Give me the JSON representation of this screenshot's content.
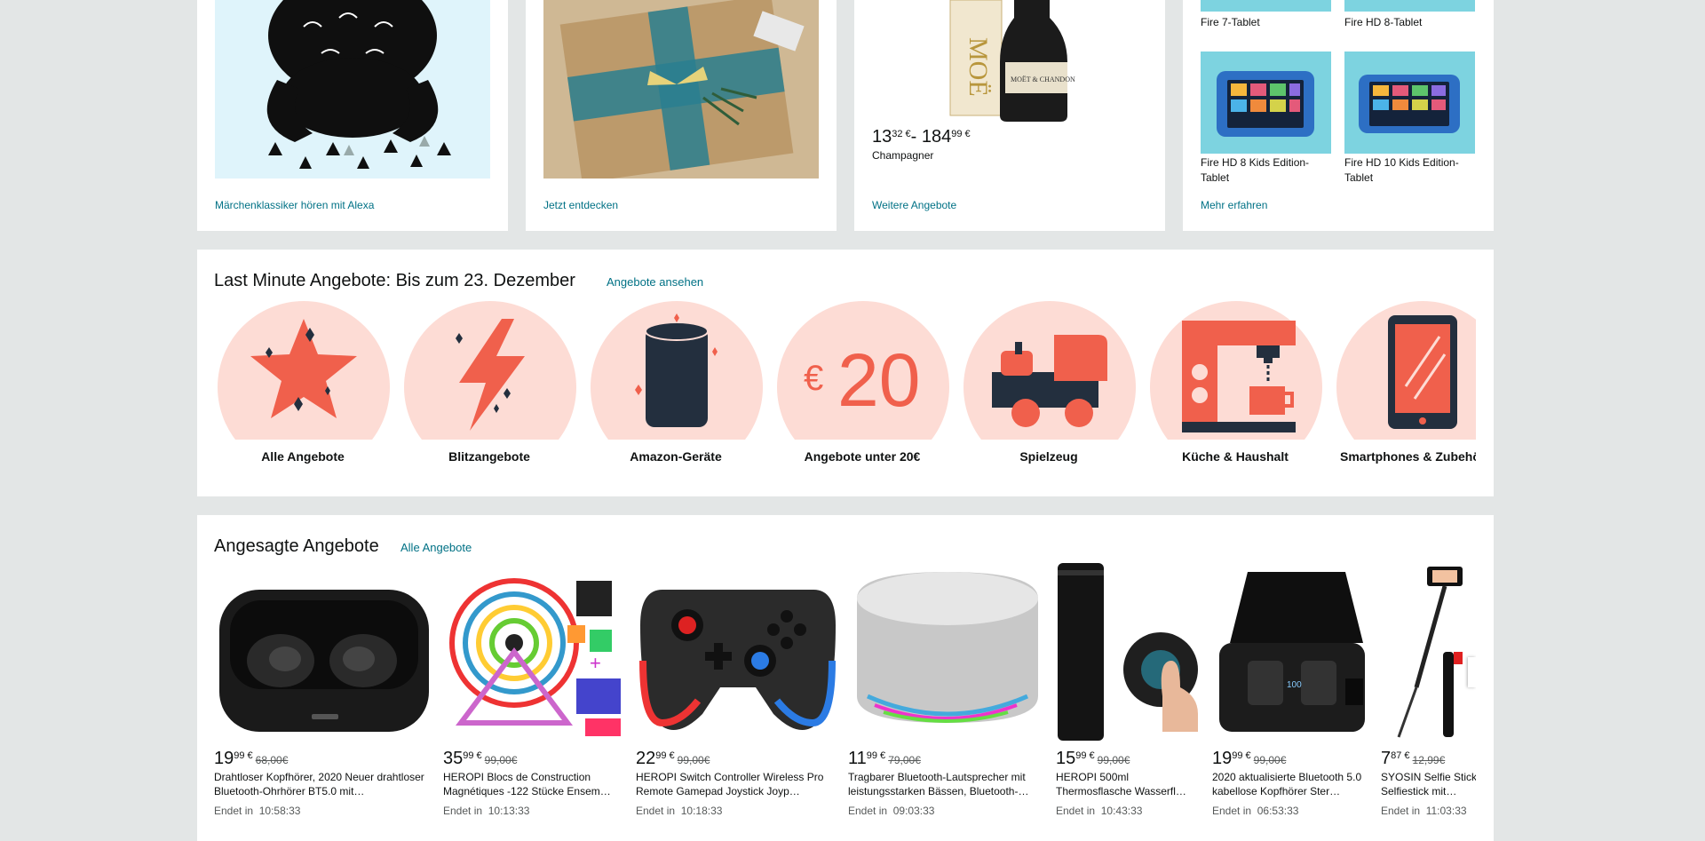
{
  "top_cards": [
    {
      "link": "Märchenklassiker hören mit Alexa"
    },
    {
      "link": "Jetzt entdecken"
    },
    {
      "price_low_main": "13",
      "price_low_sup": "32 €",
      "price_sep": "- ",
      "price_high_main": "184",
      "price_high_sup": "99 €",
      "caption": "Champagner",
      "link": "Weitere Angebote"
    },
    {
      "tablets": [
        "Fire 7-Tablet",
        "Fire HD 8-Tablet",
        "Fire HD 8 Kids Edition-Tablet",
        "Fire HD 10 Kids Edition-Tablet"
      ],
      "link": "Mehr erfahren"
    }
  ],
  "last_minute": {
    "title": "Last Minute Angebote: Bis zum 23. Dezember",
    "link": "Angebote ansehen",
    "categories": [
      {
        "label": "Alle Angebote",
        "icon": "star-icon"
      },
      {
        "label": "Blitzangebote",
        "icon": "lightning-icon"
      },
      {
        "label": "Amazon-Geräte",
        "icon": "echo-speaker-icon"
      },
      {
        "label": "Angebote unter 20€",
        "icon": "euro-20-icon"
      },
      {
        "label": "Spielzeug",
        "icon": "toy-truck-icon"
      },
      {
        "label": "Küche & Haushalt",
        "icon": "coffee-machine-icon"
      },
      {
        "label": "Smartphones & Zubehör",
        "icon": "smartphone-icon"
      }
    ]
  },
  "hot_deals": {
    "title": "Angesagte Angebote",
    "link": "Alle Angebote",
    "ends_prefix": "Endet in",
    "items": [
      {
        "price_main": "19",
        "price_sup": "99 €",
        "old_price": "68,00€",
        "title": "Drahtloser Kopfhörer, 2020 Neuer drahtloser Bluetooth-Ohrhörer BT5.0 mit…",
        "ends": "10:58:33",
        "image": "earbuds"
      },
      {
        "price_main": "35",
        "price_sup": "99 €",
        "old_price": "99,00€",
        "title": "HEROPI Blocs de Construction Magnétiques -122 Stücke Ensem…",
        "ends": "10:13:33",
        "image": "magnetic-blocks"
      },
      {
        "price_main": "22",
        "price_sup": "99 €",
        "old_price": "99,00€",
        "title": "HEROPI Switch Controller Wireless Pro Remote Gamepad Joystick Joyp…",
        "ends": "10:18:33",
        "image": "gamepad"
      },
      {
        "price_main": "11",
        "price_sup": "99 €",
        "old_price": "79,00€",
        "title": "Tragbarer Bluetooth-Lautsprecher mit leistungsstarken Bässen, Bluetooth-…",
        "ends": "09:03:33",
        "image": "speaker"
      },
      {
        "price_main": "15",
        "price_sup": "99 €",
        "old_price": "99,00€",
        "title": "HEROPI 500ml Thermosflasche Wasserfl…",
        "ends": "10:43:33",
        "image": "thermos"
      },
      {
        "price_main": "19",
        "price_sup": "99 €",
        "old_price": "99,00€",
        "title": "2020 aktualisierte Bluetooth 5.0 kabellose Kopfhörer Ster…",
        "ends": "06:53:33",
        "image": "earbuds-case"
      },
      {
        "price_main": "7",
        "price_sup": "87 €",
        "old_price": "12,99€",
        "title": "SYOSIN Selfie Stick, Mini Selfiestick mit…",
        "ends": "11:03:33",
        "image": "selfie-stick"
      }
    ]
  },
  "colors": {
    "background": "#e3e6e6",
    "link": "#007185",
    "circle": "#fddcd5",
    "icon_red": "#f0604c",
    "icon_dark": "#232f3e"
  }
}
